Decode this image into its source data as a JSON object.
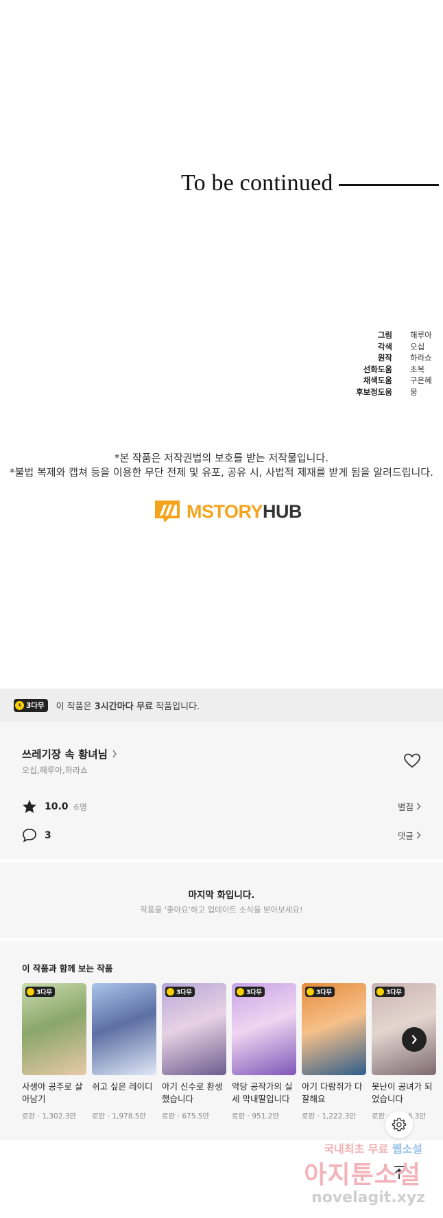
{
  "episode_end": {
    "to_be_continued": "To be continued",
    "credits": [
      {
        "role": "그림",
        "name": "해루아"
      },
      {
        "role": "각색",
        "name": "오십"
      },
      {
        "role": "원작",
        "name": "하라쇼"
      },
      {
        "role": "선화도움",
        "name": "초복"
      },
      {
        "role": "채색도움",
        "name": "구은혜"
      },
      {
        "role": "후보정도움",
        "name": "뭉"
      }
    ],
    "notice_line1": "*본 작품은 저작권법의 보호를 받는 저작물입니다.",
    "notice_line2": "*불법 복제와 캡쳐 등을 이용한 무단 전제 및 유포, 공유 시, 사법적 제재를 받게 됨을 알려드립니다.",
    "logo_part1": "MSTORY",
    "logo_part2": "HUB",
    "logo_color": "#f4a41c"
  },
  "free_banner": {
    "badge": "3다무",
    "text_prefix": "이 작품은 ",
    "text_bold": "3시간마다 무료",
    "text_suffix": " 작품입니다."
  },
  "work_info": {
    "title": "쓰레기장 속 황녀님",
    "authors": "오십,해루아,하라쇼",
    "rating": "10.0",
    "rating_count": "6명",
    "rate_label": "별점",
    "comments": "3",
    "comments_label": "댓글"
  },
  "last_episode": {
    "title": "마지막 화입니다.",
    "subtitle": "작품을 '좋아요'하고 업데이트 소식을 받아보세요!"
  },
  "recommendations": {
    "heading": "이 작품과 함께 보는 작품",
    "badge": "3다무",
    "items": [
      {
        "title": "사생아 공주로 살아남기",
        "meta": "로판 · 1,302.3만",
        "badge": true,
        "cover_colors": [
          "#c9dcae",
          "#e8c9a8",
          "#8aa66a"
        ]
      },
      {
        "title": "쉬고 싶은 레이디",
        "meta": "로판 · 1,978.5만",
        "badge": false,
        "cover_colors": [
          "#a9c3ea",
          "#dfe8f7",
          "#5d6fa3"
        ]
      },
      {
        "title": "아기 신수로 환생했습니다",
        "meta": "로판 · 675.5만",
        "badge": true,
        "cover_colors": [
          "#b7a6d8",
          "#6c5c8e",
          "#e7d2e4"
        ]
      },
      {
        "title": "악당 공작가의 실세 막내딸입니다",
        "meta": "로판 · 951.2만",
        "badge": true,
        "cover_colors": [
          "#c7a4e6",
          "#7e57b8",
          "#f0d5f1"
        ]
      },
      {
        "title": "아기 다람쥐가 다 잘해요",
        "meta": "로판 · 1,222.3만",
        "badge": true,
        "cover_colors": [
          "#e58c3a",
          "#2f5d8a",
          "#f6c08a"
        ]
      },
      {
        "title": "못난이 공녀가 되었습니다",
        "meta": "로판 · 3,026.3만",
        "badge": true,
        "cover_colors": [
          "#c8b2b0",
          "#7d6a72",
          "#e4d6cf"
        ]
      }
    ]
  },
  "watermark": {
    "line1_a": "국내최초 무료",
    "line1_b": "웹소설",
    "line2": "아지툰소설",
    "line3": "novelagit.xyz"
  }
}
